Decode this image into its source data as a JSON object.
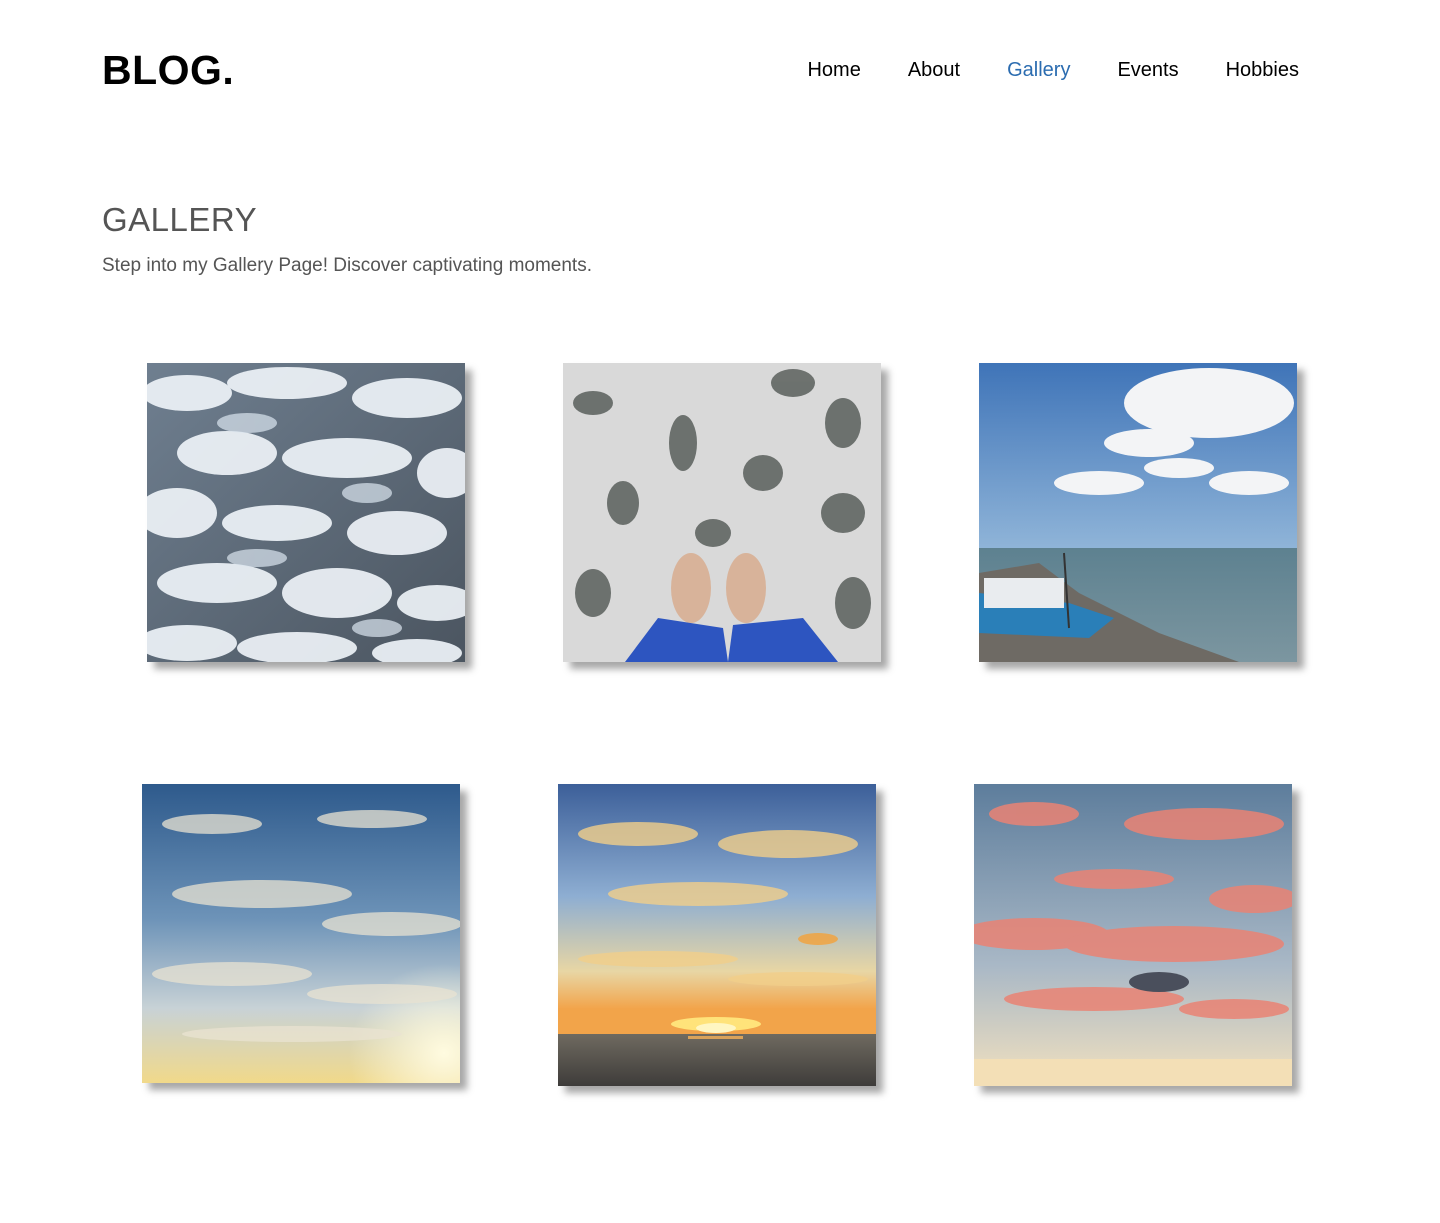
{
  "header": {
    "logo": "BLOG.",
    "nav": [
      {
        "label": "Home",
        "active": false
      },
      {
        "label": "About",
        "active": false
      },
      {
        "label": "Gallery",
        "active": true
      },
      {
        "label": "Events",
        "active": false
      },
      {
        "label": "Hobbies",
        "active": false
      }
    ],
    "accent_color": "#2b6cb0"
  },
  "page": {
    "title": "GALLERY",
    "subtitle": "Step into my Gallery Page! Discover captivating moments."
  },
  "gallery": {
    "photos": [
      {
        "subject": "sea-foam"
      },
      {
        "subject": "feet-in-surf"
      },
      {
        "subject": "beach-with-boats"
      },
      {
        "subject": "sky-clouds"
      },
      {
        "subject": "sunset-over-sea"
      },
      {
        "subject": "pink-clouds"
      }
    ]
  }
}
